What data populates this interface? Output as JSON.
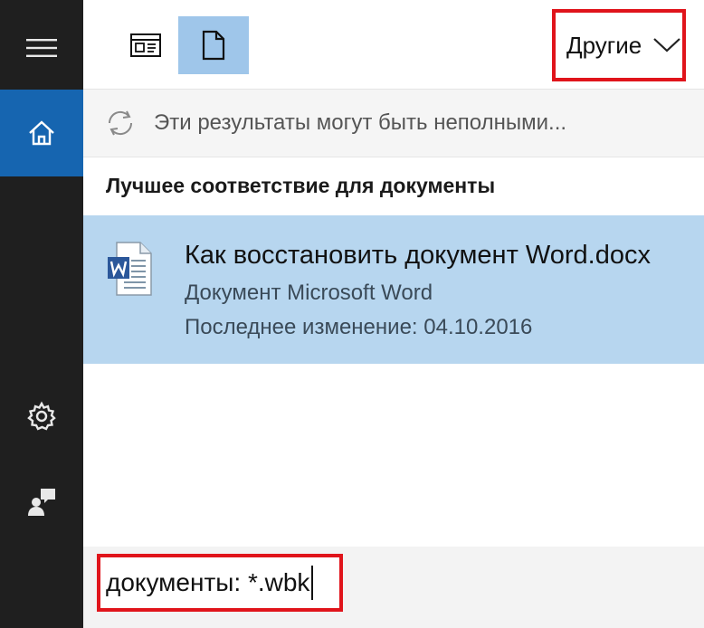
{
  "nav": {
    "menu_icon": "hamburger-icon",
    "home_icon": "home-icon",
    "settings_icon": "gear-icon",
    "feedback_icon": "feedback-icon"
  },
  "filters": {
    "apps_icon": "app-window-icon",
    "documents_icon": "document-icon",
    "others_label": "Другие"
  },
  "notice": {
    "text": "Эти результаты могут быть неполными..."
  },
  "section": {
    "title": "Лучшее соответствие для документы"
  },
  "best_match": {
    "title": "Как восстановить документ Word.docx",
    "type": "Документ Microsoft Word",
    "modified": "Последнее изменение: 04.10.2016",
    "icon": "word-document-icon"
  },
  "search": {
    "value": "документы: *.wbk"
  },
  "colors": {
    "rail": "#1f1f1f",
    "home_active": "#1665b0",
    "selected_filter": "#9fc6ea",
    "result_highlight": "#b7d6ef",
    "annotation_red": "#e0141b"
  }
}
